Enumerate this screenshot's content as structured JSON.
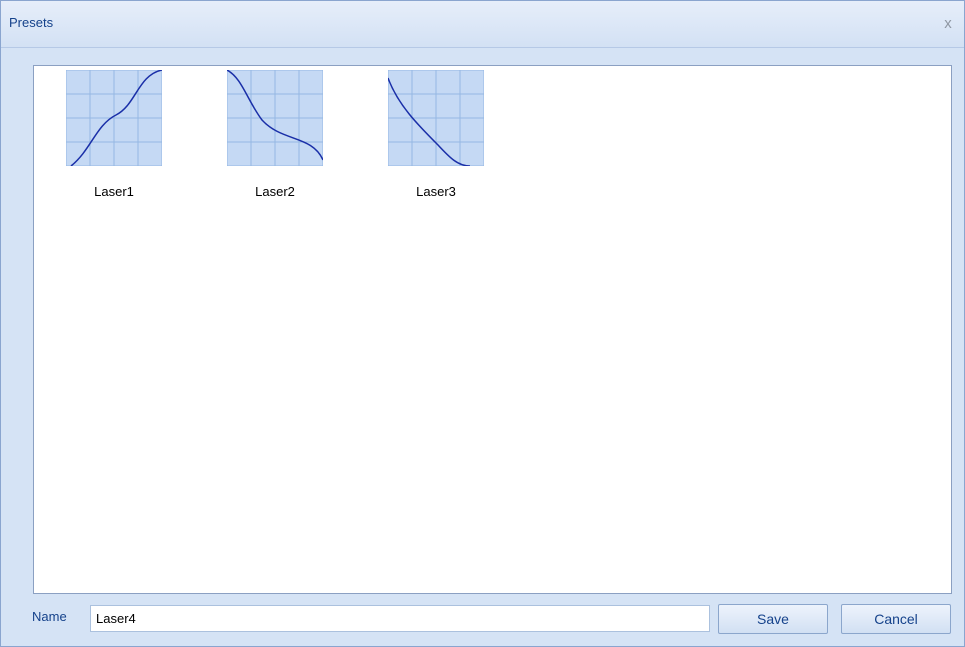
{
  "dialog": {
    "title": "Presets",
    "close_glyph": "x"
  },
  "presets": [
    {
      "label": "Laser1",
      "curve": "s-curve-rising"
    },
    {
      "label": "Laser2",
      "curve": "s-curve-falling"
    },
    {
      "label": "Laser3",
      "curve": "concave-falling"
    }
  ],
  "form": {
    "name_label": "Name",
    "name_value": "Laser4",
    "save_label": "Save",
    "cancel_label": "Cancel"
  },
  "colors": {
    "thumb_fill": "#c5d9f4",
    "thumb_grid": "#95b7e3",
    "curve": "#1a2fa8"
  }
}
